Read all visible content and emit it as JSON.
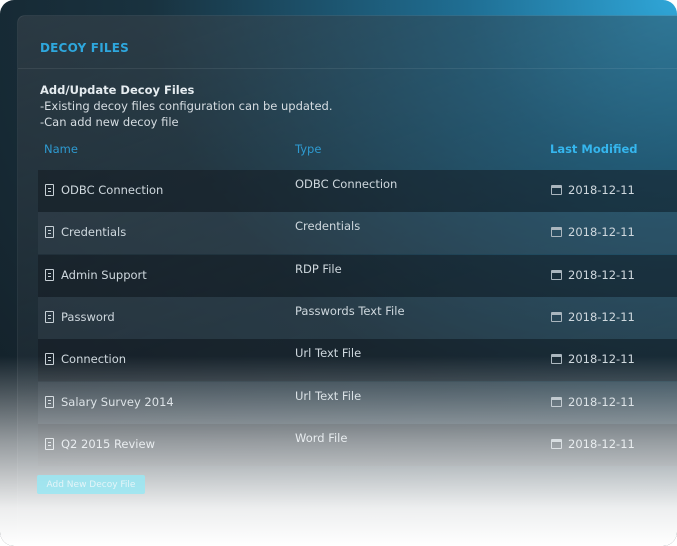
{
  "section_title": "DECOY FILES",
  "intro": {
    "heading": "Add/Update Decoy Files",
    "line1": "-Existing decoy files configuration can be updated.",
    "line2": "-Can add new decoy file"
  },
  "table": {
    "headers": {
      "name": "Name",
      "type": "Type",
      "modified": "Last Modified"
    },
    "rows": [
      {
        "name": "ODBC Connection",
        "type": "ODBC Connection",
        "modified": "2018-12-11"
      },
      {
        "name": "Credentials",
        "type": "Credentials",
        "modified": "2018-12-11"
      },
      {
        "name": "Admin Support",
        "type": "RDP File",
        "modified": "2018-12-11"
      },
      {
        "name": "Password",
        "type": "Passwords Text File",
        "modified": "2018-12-11"
      },
      {
        "name": "Connection",
        "type": "Url Text File",
        "modified": "2018-12-11"
      },
      {
        "name": "Salary Survey 2014",
        "type": "Url Text File",
        "modified": "2018-12-11"
      },
      {
        "name": "Q2 2015 Review",
        "type": "Word File",
        "modified": "2018-12-11"
      }
    ]
  },
  "add_button_label": "Add New Decoy File",
  "colors": {
    "accent": "#2ea7dd",
    "header_text": "#35b6ee",
    "button": "#9ae8f4"
  },
  "icons": {
    "row_file": "document-icon",
    "row_date": "calendar-icon"
  }
}
